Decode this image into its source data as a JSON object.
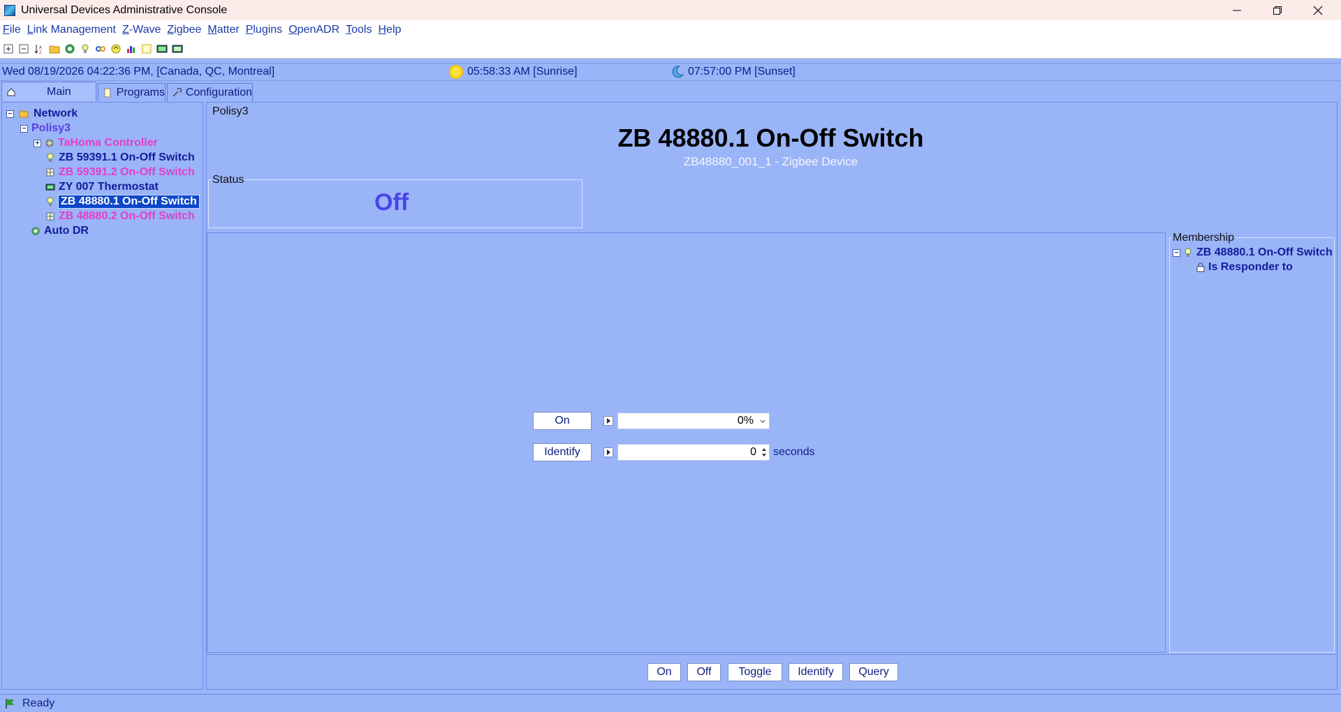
{
  "window": {
    "title": "Universal Devices Administrative Console"
  },
  "menu": [
    "File",
    "Link Management",
    "Z-Wave",
    "Zigbee",
    "Matter",
    "Plugins",
    "OpenADR",
    "Tools",
    "Help"
  ],
  "toolbar_icons": [
    "expand-all-icon",
    "collapse-all-icon",
    "sort-icon",
    "folder-icon",
    "network-icon",
    "bulb-icon",
    "link-icon",
    "power-icon",
    "chart-icon",
    "notes-icon",
    "thermostat-icon",
    "battery-icon"
  ],
  "infobar": {
    "datetime": "Wed 08/19/2026 04:22:36 PM,  [Canada, QC, Montreal]",
    "sunrise": "05:58:33 AM [Sunrise]",
    "sunset": "07:57:00 PM [Sunset]"
  },
  "tabs": {
    "main": "Main",
    "programs": "Programs",
    "configuration": "Configuration"
  },
  "tree": {
    "network": "Network",
    "polisy": "Polisy3",
    "tahoma": "TaHoma Controller",
    "zb59391_1": "ZB 59391.1 On-Off Switch",
    "zb59391_2": "ZB 59391.2 On-Off Switch",
    "zy007": "ZY 007 Thermostat",
    "zb48880_1": "ZB 48880.1 On-Off Switch",
    "zb48880_2": "ZB 48880.2 On-Off Switch",
    "autodr": "Auto DR"
  },
  "device": {
    "group_label": "Polisy3",
    "title": "ZB 48880.1 On-Off Switch",
    "subtitle": "ZB48880_001_1 - Zigbee Device"
  },
  "status": {
    "label": "Status",
    "value": "Off"
  },
  "controls": {
    "on_label": "On",
    "on_value": "0%",
    "identify_label": "Identify",
    "identify_value": "0",
    "identify_unit": "seconds"
  },
  "membership": {
    "label": "Membership",
    "device": "ZB 48880.1 On-Off Switch",
    "role": "Is Responder to"
  },
  "bottom_buttons": {
    "on": "On",
    "off": "Off",
    "toggle": "Toggle",
    "identify": "Identify",
    "query": "Query"
  },
  "statusbar": {
    "text": "Ready"
  },
  "colors": {
    "background": "#9ab4f8",
    "selected": "#0d47c9",
    "pink_device": "#e43ec7",
    "navy_text": "#0f1e9a"
  }
}
